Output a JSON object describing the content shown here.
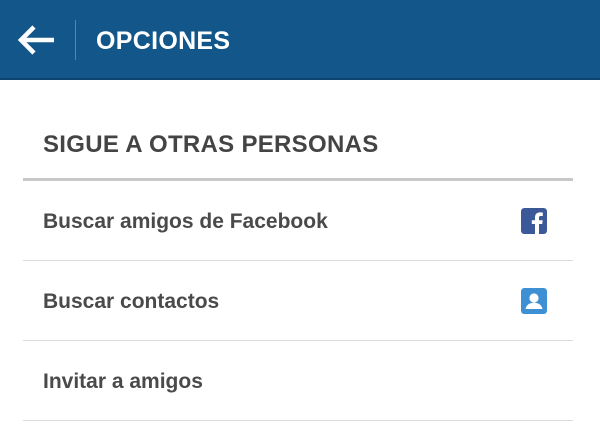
{
  "header": {
    "back_icon": "arrow-left-icon",
    "title": "OPCIONES"
  },
  "section": {
    "title": "SIGUE A OTRAS PERSONAS"
  },
  "items": [
    {
      "label": "Buscar amigos de Facebook",
      "icon": "facebook-icon"
    },
    {
      "label": "Buscar contactos",
      "icon": "contact-icon"
    },
    {
      "label": "Invitar a amigos"
    }
  ],
  "colors": {
    "header_bg": "#12568a",
    "facebook_blue": "#3b5998",
    "contact_blue": "#3d90d4"
  }
}
